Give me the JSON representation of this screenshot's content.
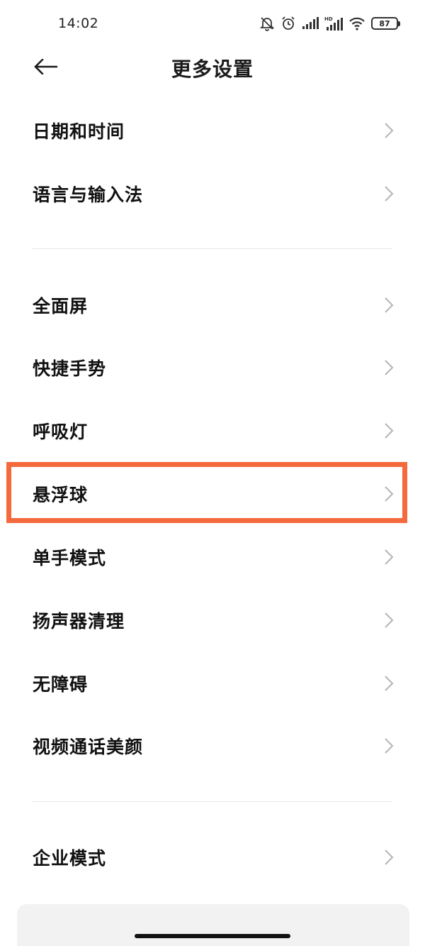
{
  "status_bar": {
    "time": "14:02",
    "battery": "87",
    "icons": [
      "mute-bell-icon",
      "alarm-icon",
      "signal-icon",
      "hd-signal-icon",
      "wifi-icon",
      "battery-icon"
    ]
  },
  "header": {
    "title": "更多设置",
    "back_icon": "arrow-left-icon"
  },
  "groups": [
    {
      "items": [
        {
          "label": "日期和时间"
        },
        {
          "label": "语言与输入法"
        }
      ]
    },
    {
      "items": [
        {
          "label": "全面屏"
        },
        {
          "label": "快捷手势"
        },
        {
          "label": "呼吸灯"
        },
        {
          "label": "悬浮球",
          "highlighted": true
        },
        {
          "label": "单手模式"
        },
        {
          "label": "扬声器清理"
        },
        {
          "label": "无障碍"
        },
        {
          "label": "视频通话美颜"
        }
      ]
    },
    {
      "items": [
        {
          "label": "企业模式"
        }
      ]
    }
  ],
  "colors": {
    "highlight": "#f46a3c",
    "chevron": "#b5b5b5",
    "divider": "#e6e6e6"
  }
}
